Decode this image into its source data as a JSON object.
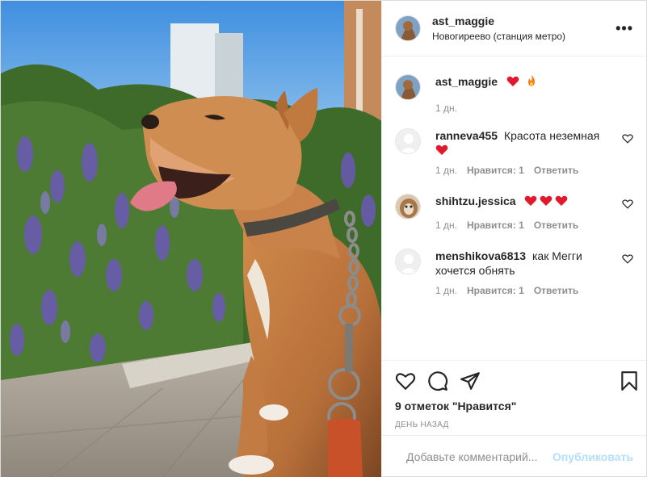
{
  "post": {
    "author": "ast_maggie",
    "location": "Новогиреево (станция метро)",
    "more_icon": "more-horizontal-icon"
  },
  "caption": {
    "username": "ast_maggie",
    "emoji": [
      "red-heart",
      "fire"
    ],
    "time": "1 дн."
  },
  "comments": [
    {
      "username": "ranneva455",
      "text": "Красота неземная",
      "emoji_count": 1,
      "time": "1 дн.",
      "likes": "Нравится: 1",
      "reply": "Ответить"
    },
    {
      "username": "shihtzu.jessica",
      "text": "",
      "emoji_count": 3,
      "time": "1 дн.",
      "likes": "Нравится: 1",
      "reply": "Ответить"
    },
    {
      "username": "menshikova6813",
      "text": "как Мегги хочется обнять",
      "emoji_count": 0,
      "time": "1 дн.",
      "likes": "Нравится: 1",
      "reply": "Ответить"
    }
  ],
  "actions": {
    "likes": "9 отметок \"Нравится\"",
    "date": "ДЕНЬ НАЗАД"
  },
  "add_comment": {
    "placeholder": "Добавьте комментарий...",
    "publish": "Опубликовать"
  },
  "colors": {
    "text": "#262626",
    "muted": "#8e8e8e",
    "publish_disabled": "#b2dffc",
    "heart": "#ed4956"
  }
}
